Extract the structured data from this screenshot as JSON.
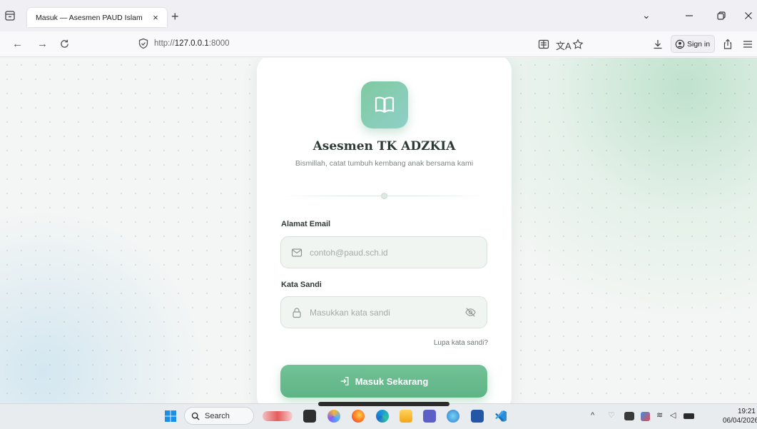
{
  "browser": {
    "tab_title": "Masuk — Asesmen PAUD Islam",
    "tab_close": "×",
    "new_tab": "+",
    "url_prefix": "http://",
    "url_host": "127.0.0.1",
    "url_port": ":8000",
    "signin_label": "Sign in",
    "icons": [
      "tab-list-icon",
      "back-icon",
      "forward-icon",
      "reload-icon",
      "shield-icon",
      "reader-view-icon",
      "translate-icon",
      "bookmark-star-icon",
      "download-icon",
      "account-icon",
      "share-icon",
      "menu-icon",
      "minimize-icon",
      "maximize-icon",
      "close-window-icon",
      "tab-dropdown-icon"
    ]
  },
  "page": {
    "title": "Asesmen TK ADZKIA",
    "subtitle": "Bismillah, catat tumbuh kembang anak bersama kami",
    "email_label": "Alamat Email",
    "email_placeholder": "contoh@paud.sch.id",
    "password_label": "Kata Sandi",
    "password_placeholder": "Masukkan kata sandi",
    "forgot_link": "Lupa kata sandi?",
    "submit_label": "Masuk Sekarang",
    "accent_color": "#66b98b",
    "logo_gradient": [
      "#7fc9a0",
      "#8fd0c8"
    ]
  },
  "taskbar": {
    "search_label": "Search",
    "time": "19:21",
    "date": "06/04/2026"
  }
}
